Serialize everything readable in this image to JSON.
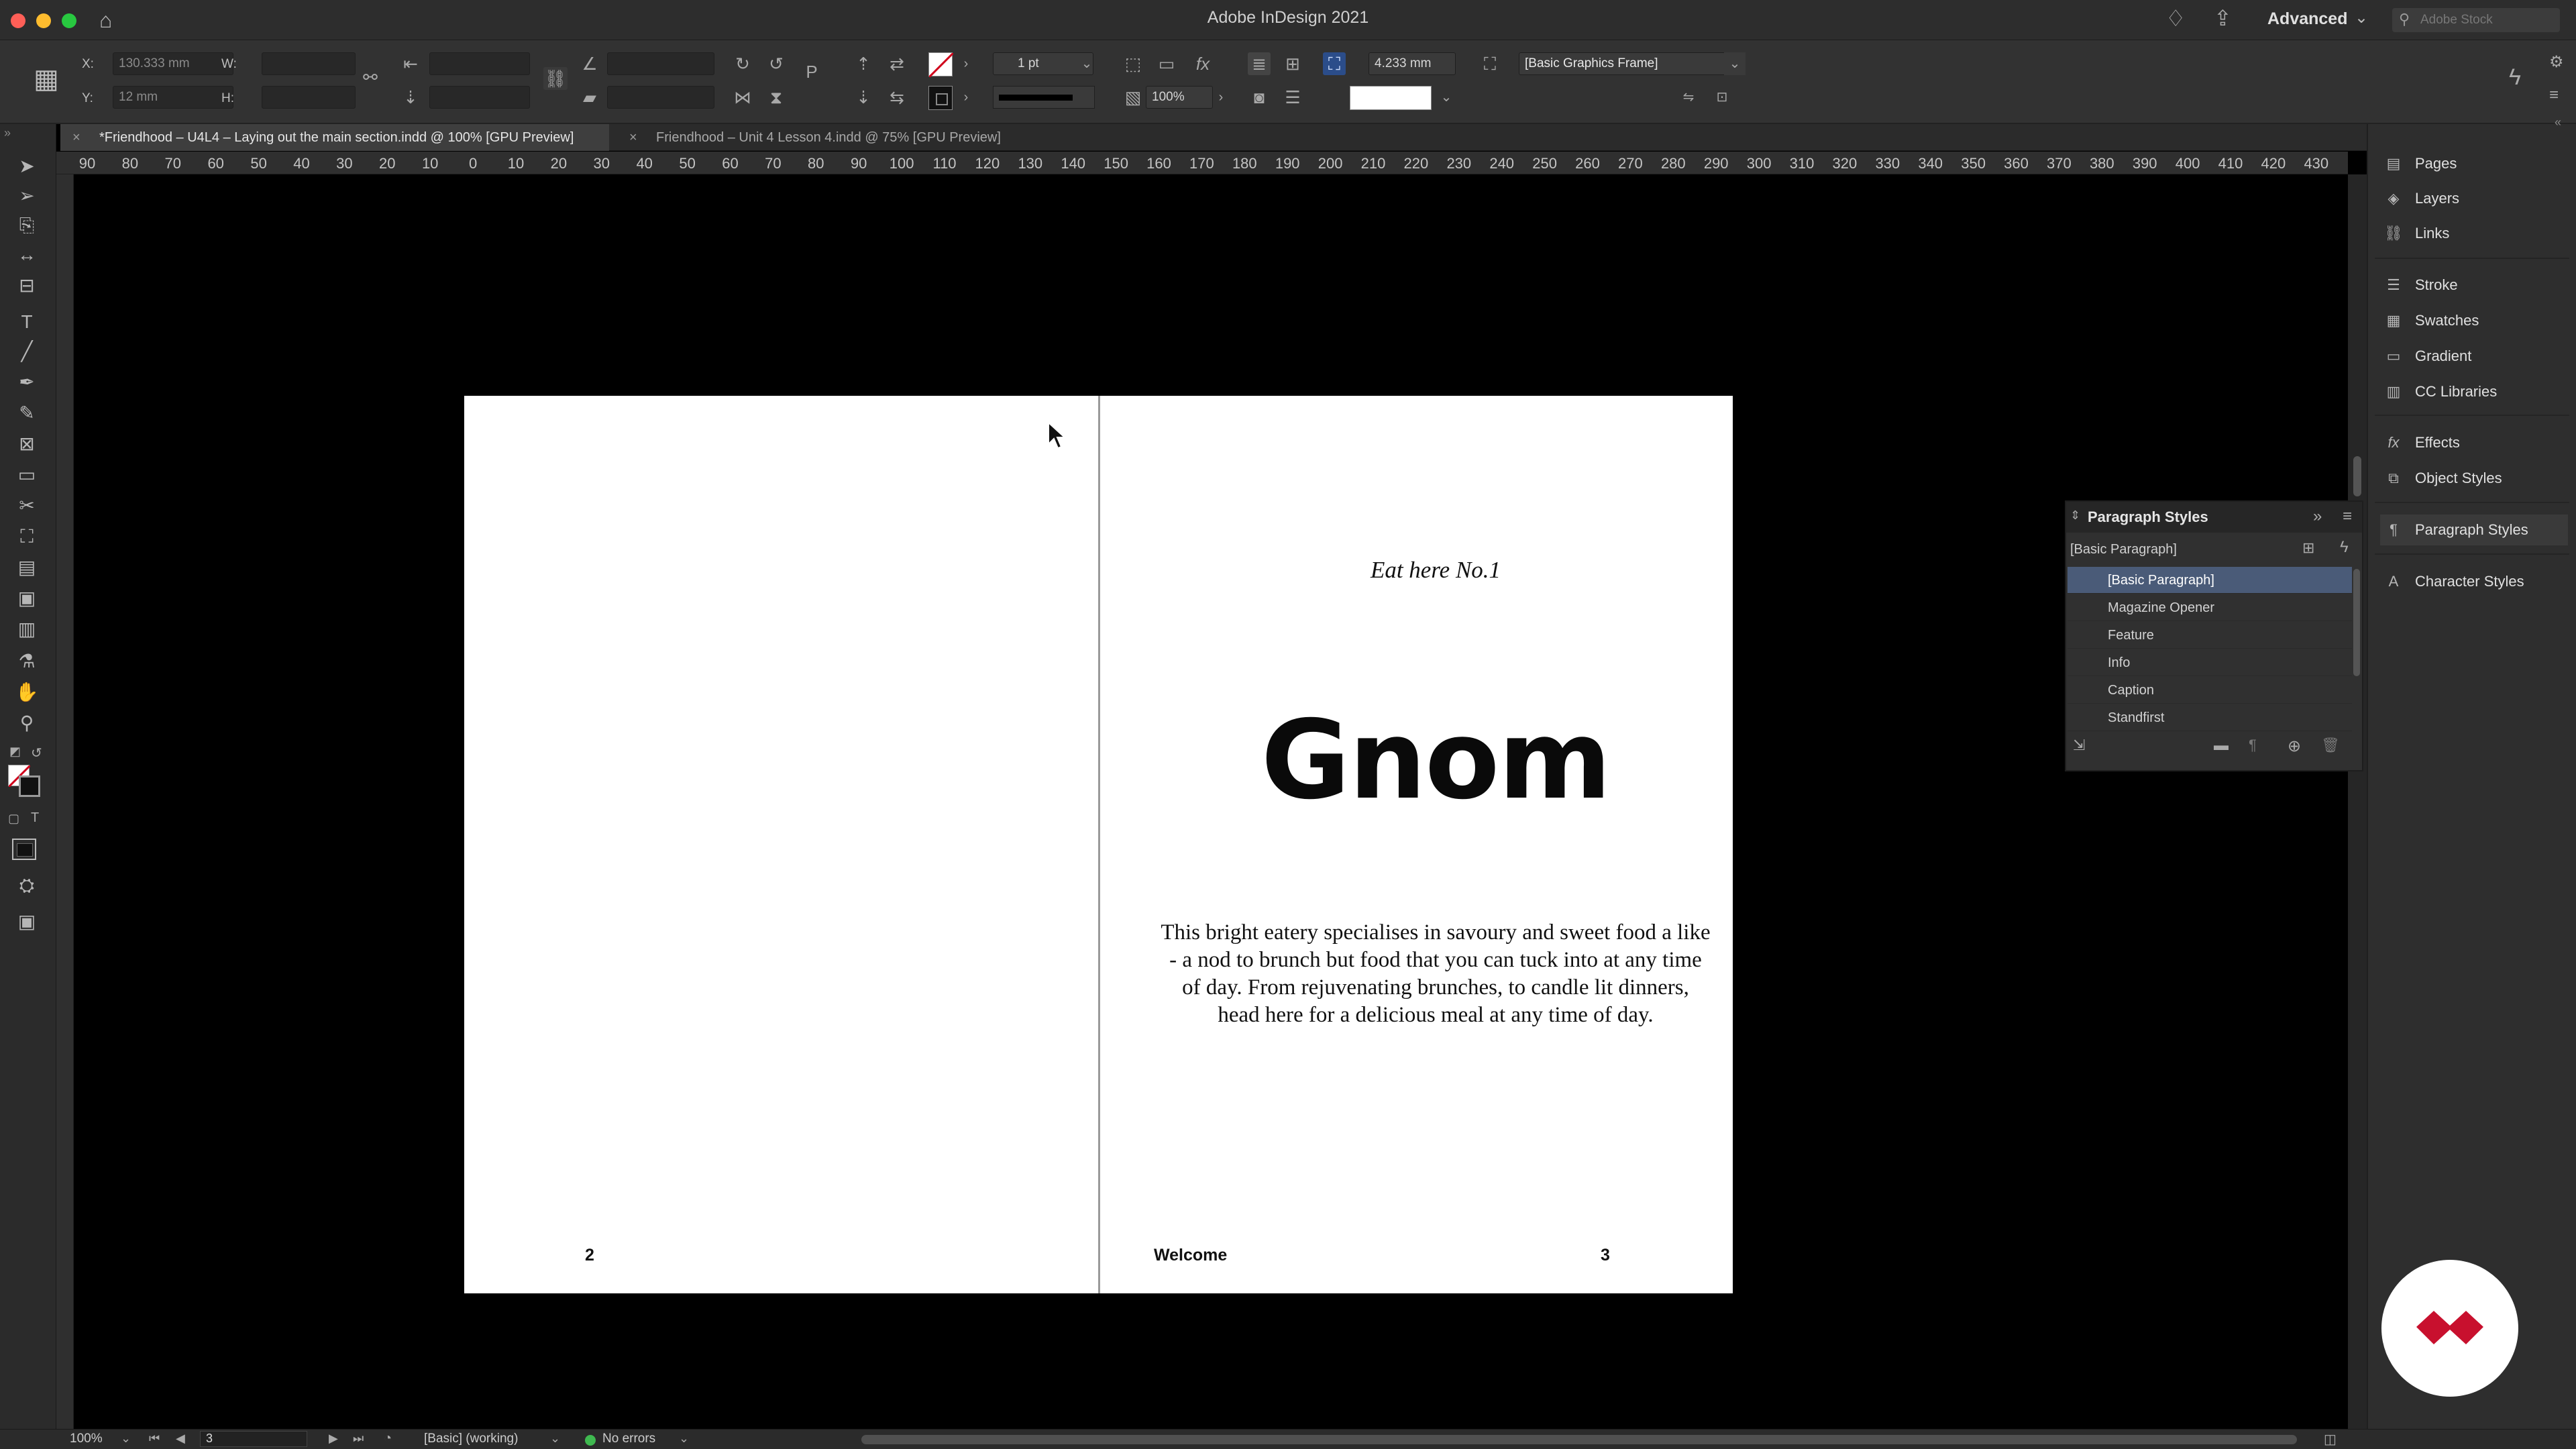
{
  "app": {
    "title": "Adobe InDesign 2021",
    "workspace": "Advanced",
    "search_placeholder": "Adobe Stock"
  },
  "control_bar": {
    "x_label": "X:",
    "x_value": "130.333 mm",
    "y_label": "Y:",
    "y_value": "12 mm",
    "w_label": "W:",
    "h_label": "H:",
    "stroke_weight": "1 pt",
    "opacity": "100%",
    "offset_value": "4.233 mm",
    "object_style": "[Basic Graphics Frame]"
  },
  "tabs": [
    {
      "label": "*Friendhood – U4L4 – Laying out the main section.indd @ 100% [GPU Preview]",
      "active": true
    },
    {
      "label": "Friendhood – Unit 4 Lesson 4.indd @ 75% [GPU Preview]",
      "active": false
    }
  ],
  "ruler": {
    "ticks": [
      "90",
      "80",
      "70",
      "60",
      "50",
      "40",
      "30",
      "20",
      "10",
      "0",
      "10",
      "20",
      "30",
      "40",
      "50",
      "60",
      "70",
      "80",
      "90",
      "100",
      "110",
      "120",
      "130",
      "140",
      "150",
      "160",
      "170",
      "180",
      "190",
      "200",
      "210",
      "220",
      "230",
      "240",
      "250",
      "260",
      "270",
      "280",
      "290",
      "300",
      "310",
      "320",
      "330",
      "340",
      "350",
      "360",
      "370",
      "380",
      "390",
      "400",
      "410",
      "420",
      "430"
    ]
  },
  "spread": {
    "right_kicker": "Eat here No.1",
    "headline": "Gnom",
    "body": "This bright eatery specialises in savoury and sweet food a like - a nod to brunch but food that you can tuck into at any time of day. From rejuvenating brunches, to candle lit dinners, head here for a delicious meal at any time of day.",
    "left_folio": "2",
    "section_label": "Welcome",
    "right_folio": "3"
  },
  "dock": {
    "group1": [
      {
        "icon": "pages-icon",
        "label": "Pages"
      },
      {
        "icon": "layers-icon",
        "label": "Layers"
      },
      {
        "icon": "links-icon",
        "label": "Links"
      }
    ],
    "group2": [
      {
        "icon": "stroke-icon",
        "label": "Stroke"
      },
      {
        "icon": "swatches-icon",
        "label": "Swatches"
      },
      {
        "icon": "gradient-icon",
        "label": "Gradient"
      },
      {
        "icon": "cc-libraries-icon",
        "label": "CC Libraries"
      }
    ],
    "group3": [
      {
        "icon": "effects-icon",
        "label": "Effects"
      },
      {
        "icon": "object-styles-icon",
        "label": "Object Styles"
      }
    ],
    "group4": [
      {
        "icon": "paragraph-styles-icon",
        "label": "Paragraph Styles"
      }
    ],
    "group5": [
      {
        "icon": "character-styles-icon",
        "label": "Character Styles"
      }
    ]
  },
  "paragraph_styles_panel": {
    "title": "Paragraph Styles",
    "current": "[Basic Paragraph]",
    "styles": [
      "[Basic Paragraph]",
      "Magazine Opener",
      "Feature",
      "Info",
      "Caption",
      "Standfirst"
    ],
    "selected_index": 0
  },
  "status_bar": {
    "zoom": "100%",
    "page": "3",
    "style": "[Basic] (working)",
    "preflight": "No errors"
  },
  "colors": {
    "selection": "#4a5b78",
    "accent_red": "#c8102e",
    "status_green": "#3fb950"
  }
}
